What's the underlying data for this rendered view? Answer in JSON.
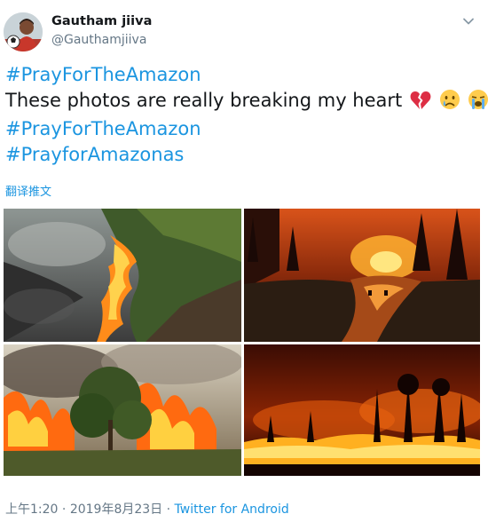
{
  "user": {
    "display_name": "Gautham jiiva",
    "handle": "@Gauthamjiiva",
    "avatar_icon": "profile-photo-soccer"
  },
  "tweet": {
    "lines": [
      {
        "hashtag": "#PrayForTheAmazon"
      },
      {
        "text": "These photos are really breaking my heart",
        "emojis": [
          "broken-heart",
          "crying-face",
          "loudly-crying-face"
        ]
      },
      {
        "hashtag": "#PrayForTheAmazon"
      },
      {
        "hashtag": "#PrayforAmazonas"
      }
    ],
    "translate_label": "翻译推文"
  },
  "media": [
    {
      "description_icon": "photo-burning-grass-smoke"
    },
    {
      "description_icon": "photo-forest-fire-river"
    },
    {
      "description_icon": "photo-forest-fire-trees"
    },
    {
      "description_icon": "photo-night-forest-fire"
    }
  ],
  "meta": {
    "time": "上午1:20",
    "separator": "·",
    "date": "2019年8月23日",
    "source": "Twitter for Android"
  },
  "colors": {
    "link": "#1b95e0",
    "secondary_text": "#657786"
  }
}
